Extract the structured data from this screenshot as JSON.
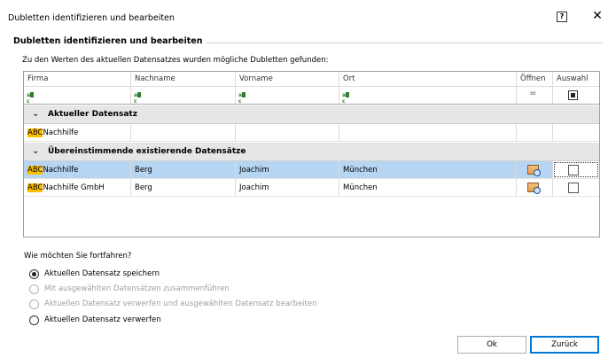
{
  "window": {
    "title": "Dubletten identifizieren und bearbeiten",
    "help_label": "?",
    "close_label": "✕"
  },
  "group": {
    "title": "Dubletten identifizieren und bearbeiten",
    "intro": "Zu den Werten des aktuellen Datensatzes wurden mögliche Dubletten gefunden:"
  },
  "grid": {
    "columns": [
      "Firma",
      "Nachname",
      "Vorname",
      "Ort",
      "Öffnen",
      "Auswahl"
    ],
    "filter_symbol": "=",
    "current_group_label": "Aktueller Datensatz",
    "matches_group_label": "Übereinstimmende existierende Datensätze",
    "current_row": {
      "firma_hl": "ABC",
      "firma_rest": "Nachhilfe",
      "nachname": "",
      "vorname": "",
      "ort": ""
    },
    "matches": [
      {
        "firma_hl": "ABC",
        "firma_rest": "Nachhilfe",
        "nachname": "Berg",
        "vorname": "Joachim",
        "ort": "München",
        "selected": true
      },
      {
        "firma_hl": "ABC",
        "firma_rest": "Nachhilfe GmbH",
        "nachname": "Berg",
        "vorname": "Joachim",
        "ort": "München",
        "selected": false
      }
    ]
  },
  "options": {
    "question": "Wie möchten Sie fortfahren?",
    "items": [
      {
        "label": "Aktuellen Datensatz speichern",
        "checked": true,
        "enabled": true
      },
      {
        "label": "Mit ausgewählten Datensätzen zusammenführen",
        "checked": false,
        "enabled": false
      },
      {
        "label": "Aktuellen Datensatz verwerfen und ausgewählten Datensatz bearbeiten",
        "checked": false,
        "enabled": false
      },
      {
        "label": "Aktuellen Datensatz verwerfen",
        "checked": false,
        "enabled": true
      }
    ]
  },
  "buttons": {
    "ok": "Ok",
    "back": "Zurück"
  },
  "colors": {
    "selection": "#b5d5f2",
    "highlight": "#ffc000",
    "accent": "#0078d7"
  }
}
